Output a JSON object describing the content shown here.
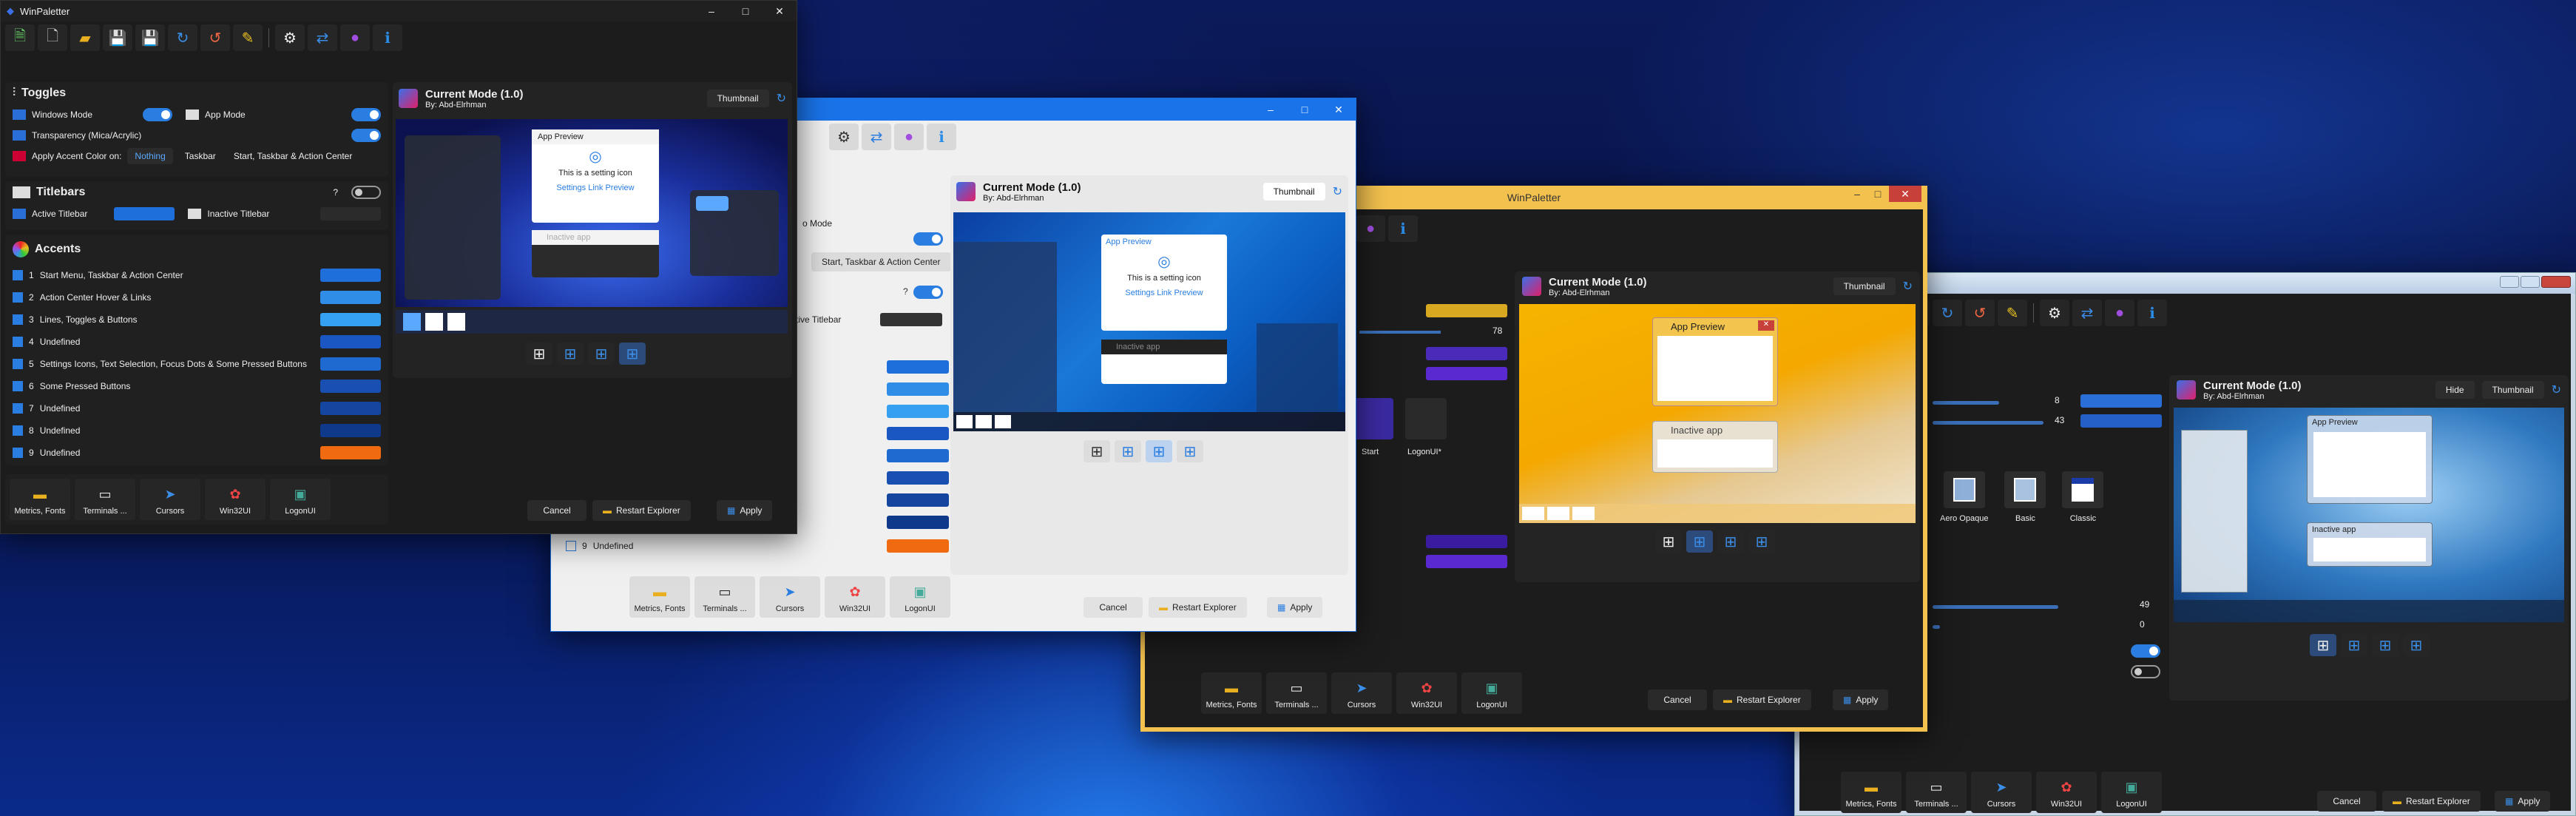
{
  "w1": {
    "title": "WinPaletter",
    "mode_title": "Current Mode (1.0)",
    "author": "By: Abd-Elrhman",
    "thumbnail": "Thumbnail",
    "toggles_title": "Toggles",
    "windows_mode": "Windows Mode",
    "app_mode": "App Mode",
    "transparency": "Transparency (Mica/Acrylic)",
    "accent_on": "Apply Accent Color on:",
    "seg_nothing": "Nothing",
    "seg_taskbar": "Taskbar",
    "seg_start": "Start, Taskbar & Action Center",
    "titlebars": "Titlebars",
    "active_titlebar": "Active Titlebar",
    "inactive_titlebar": "Inactive Titlebar",
    "q": "?",
    "accents": "Accents",
    "accent_rows": [
      {
        "n": "1",
        "label": "Start Menu, Taskbar & Action Center",
        "color": "#1e6fd9"
      },
      {
        "n": "2",
        "label": "Action Center Hover & Links",
        "color": "#2f8de8"
      },
      {
        "n": "3",
        "label": "Lines, Toggles & Buttons",
        "color": "#35a0ef"
      },
      {
        "n": "4",
        "label": "Undefined",
        "color": "#1a57c2"
      },
      {
        "n": "5",
        "label": "Settings Icons, Text Selection, Focus Dots & Some Pressed Buttons",
        "color": "#1f6ad0"
      },
      {
        "n": "6",
        "label": "Some Pressed Buttons",
        "color": "#184fb0"
      },
      {
        "n": "7",
        "label": "Undefined",
        "color": "#1446a0"
      },
      {
        "n": "8",
        "label": "Undefined",
        "color": "#0f3a8c"
      },
      {
        "n": "9",
        "label": "Undefined",
        "color": "#f06a10"
      }
    ],
    "app_preview": "App Preview",
    "setting_icon": "This is a setting icon",
    "settings_link": "Settings Link Preview",
    "inactive_app": "Inactive app",
    "bottom": [
      "Metrics, Fonts",
      "Terminals ...",
      "Cursors",
      "Win32UI",
      "LogonUI"
    ],
    "cancel": "Cancel",
    "restart": "Restart Explorer",
    "apply": "Apply"
  },
  "w2": {
    "mode_title": "Current Mode (1.0)",
    "author": "By: Abd-Elrhman",
    "thumbnail": "Thumbnail",
    "app_mode": "o Mode",
    "seg_start": "Start, Taskbar & Action Center",
    "inactive_titlebar": "ctive Titlebar",
    "q": "?",
    "app_preview": "App Preview",
    "setting_icon": "This is a setting icon",
    "settings_link": "Settings Link Preview",
    "inactive_app": "Inactive app",
    "last_n": "9",
    "last_label": "Undefined",
    "bottom": [
      "Metrics, Fonts",
      "Terminals ...",
      "Cursors",
      "Win32UI",
      "LogonUI"
    ],
    "cancel": "Cancel",
    "restart": "Restart Explorer",
    "apply": "Apply"
  },
  "w3": {
    "title": "WinPaletter",
    "mode_title": "Current Mode (1.0)",
    "author": "By: Abd-Elrhman",
    "thumbnail": "Thumbnail",
    "slider_val": "78",
    "app_preview": "App Preview",
    "inactive_app": "Inactive app",
    "start": "Start",
    "logonui": "LogonUI*",
    "bottom": [
      "Metrics, Fonts",
      "Terminals ...",
      "Cursors",
      "Win32UI",
      "LogonUI"
    ],
    "cancel": "Cancel",
    "restart": "Restart Explorer",
    "apply": "Apply"
  },
  "w4": {
    "mode_title": "Current Mode (1.0)",
    "author": "By: Abd-Elrhman",
    "hide": "Hide",
    "thumbnail": "Thumbnail",
    "v1": "8",
    "v2": "43",
    "v3": "49",
    "v4": "0",
    "app_preview": "App Preview",
    "inactive_app": "Inactive app",
    "styles": [
      "Aero Opaque",
      "Basic",
      "Classic"
    ],
    "bottom": [
      "Metrics, Fonts",
      "Terminals ...",
      "Cursors",
      "Win32UI",
      "LogonUI"
    ],
    "cancel": "Cancel",
    "restart": "Restart Explorer",
    "apply": "Apply"
  }
}
